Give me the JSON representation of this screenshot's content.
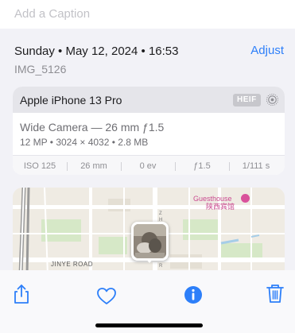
{
  "caption": {
    "placeholder": "Add a Caption",
    "value": ""
  },
  "info": {
    "date_line": "Sunday • May 12, 2024 • 16:53",
    "file_name": "IMG_5126",
    "adjust_label": "Adjust"
  },
  "device": {
    "name": "Apple iPhone 13 Pro",
    "format_badge": "HEIF",
    "camera": "Wide Camera — 26 mm ƒ1.5",
    "specs": "12 MP • 3024 × 4032 • 2.8 MB",
    "exif": [
      "ISO 125",
      "26 mm",
      "0 ev",
      "ƒ1.5",
      "1/111 s"
    ]
  },
  "map": {
    "poi_name_en": "Guesthouse",
    "poi_name_cn": "陕西宾馆",
    "road_name": "JINYE ROAD"
  },
  "toolbar": {
    "share": "share-icon",
    "favorite": "heart-icon",
    "info": "info-icon",
    "delete": "trash-icon"
  },
  "colors": {
    "accent": "#2d7ff9",
    "background": "#f2f2f7",
    "poi": "#d9519b"
  }
}
